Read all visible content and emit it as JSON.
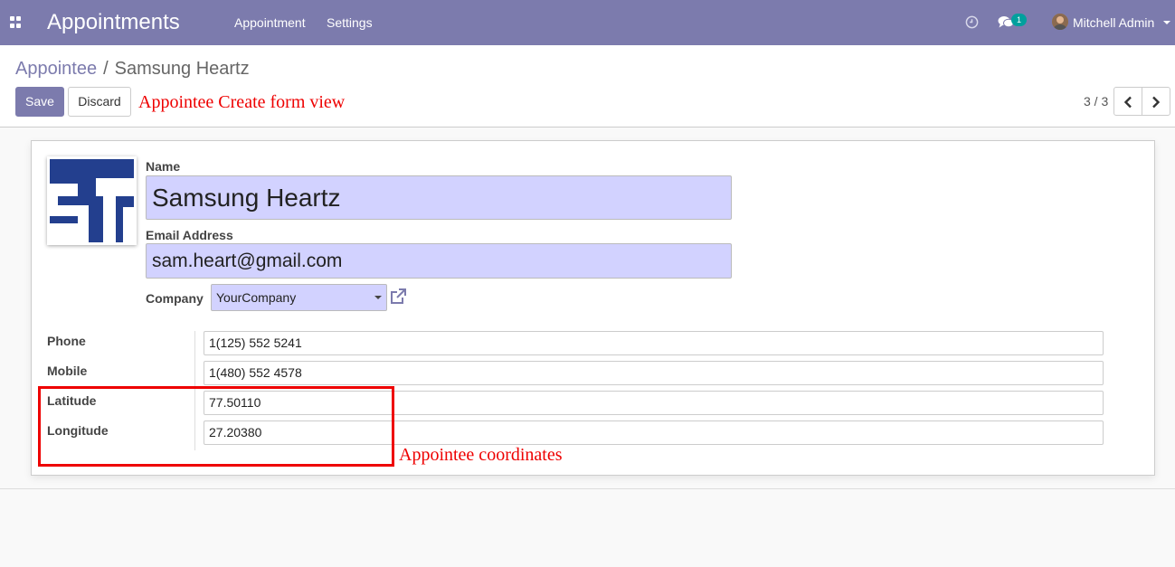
{
  "navbar": {
    "app_title": "Appointments",
    "menu": [
      "Appointment",
      "Settings"
    ],
    "chat_count": "1",
    "user_name": "Mitchell Admin"
  },
  "breadcrumb": {
    "parent": "Appointee",
    "separator": "/",
    "current": "Samsung Heartz"
  },
  "toolbar": {
    "save_label": "Save",
    "discard_label": "Discard"
  },
  "pager": {
    "value": "3 / 3"
  },
  "annotations": {
    "form": "Appointee Create form view",
    "coordinates": "Appointee coordinates"
  },
  "form": {
    "name_label": "Name",
    "name_value": "Samsung Heartz",
    "email_label": "Email Address",
    "email_value": "sam.heart@gmail.com",
    "company_label": "Company",
    "company_value": "YourCompany",
    "phone_label": "Phone",
    "phone_value": "1(125) 552 5241",
    "mobile_label": "Mobile",
    "mobile_value": "1(480) 552 4578",
    "latitude_label": "Latitude",
    "latitude_value": "77.50110",
    "longitude_label": "Longitude",
    "longitude_value": "27.20380"
  },
  "colors": {
    "brand": "#7c7bad",
    "required_field": "#d2d2ff",
    "annotation": "#ee0000",
    "logo_blue": "#233f8e"
  },
  "icons": [
    "apps-grid-icon",
    "clock-icon",
    "chat-icon",
    "user-avatar",
    "chevron-left-icon",
    "chevron-right-icon",
    "external-link-icon",
    "company-logo"
  ]
}
